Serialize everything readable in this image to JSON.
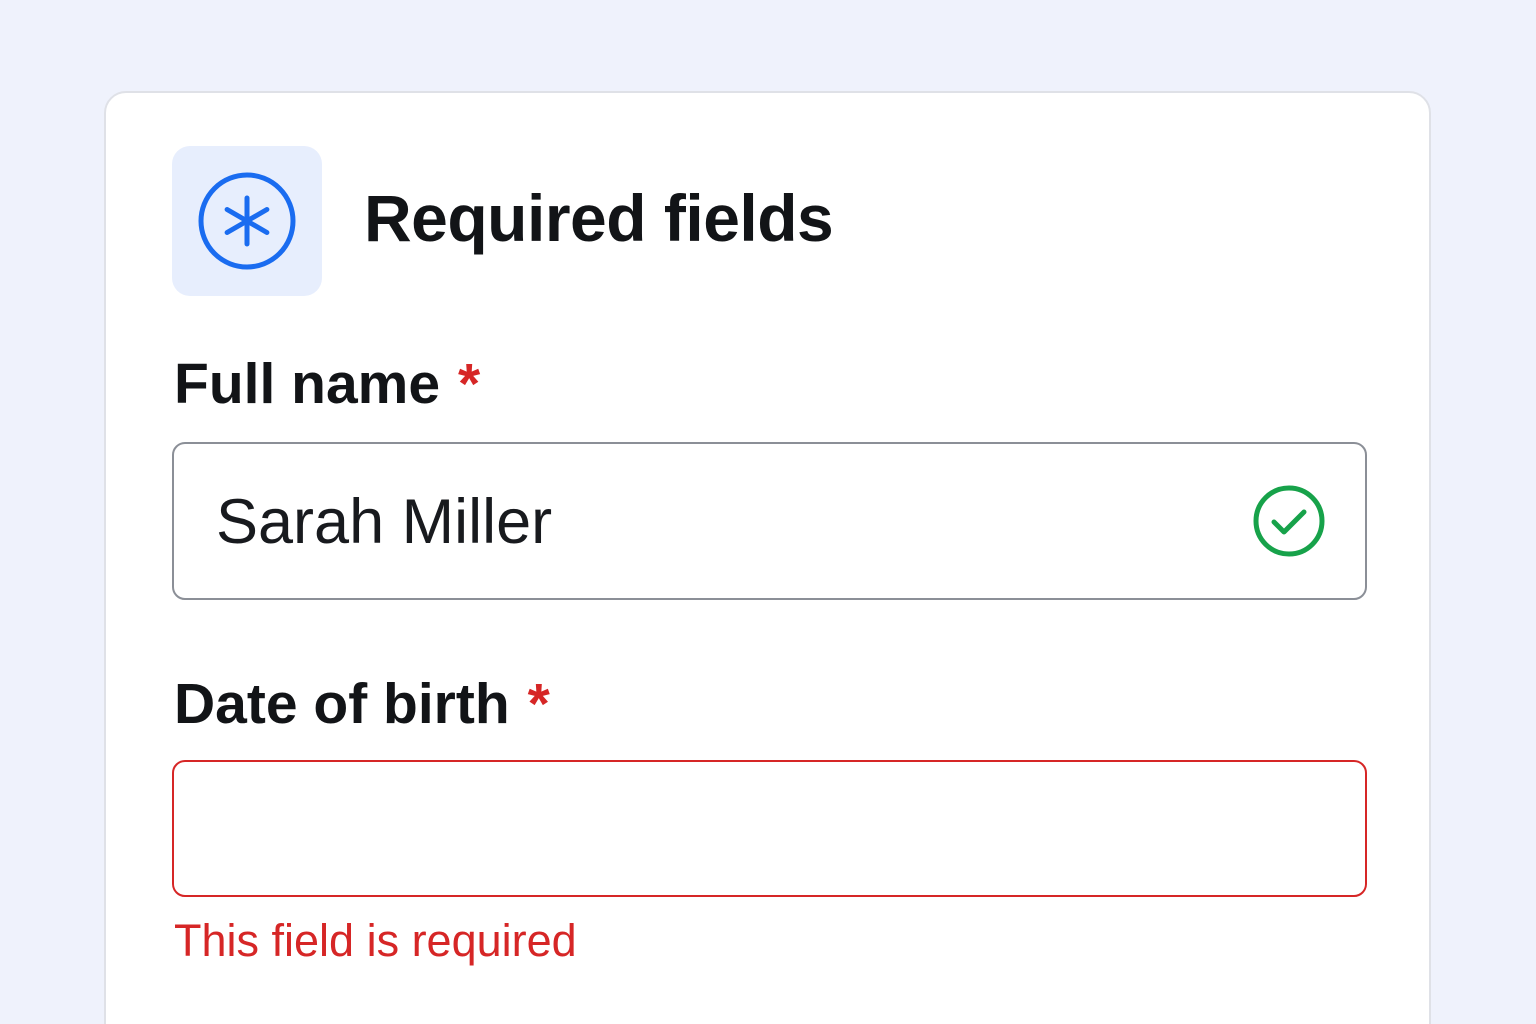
{
  "header": {
    "icon": "asterisk-circle-icon",
    "title": "Required fields"
  },
  "fields": [
    {
      "label": "Full name",
      "required_mark": "*",
      "value": "Sarah Miller",
      "status_icon": "check-circle-icon",
      "state": "valid"
    },
    {
      "label": "Date of birth",
      "required_mark": "*",
      "value": "",
      "state": "error",
      "error_message": "This field is required"
    }
  ],
  "colors": {
    "background": "#eff2fc",
    "accent_blue": "#1a6cf0",
    "error_red": "#d62626",
    "success_green": "#17a24a"
  }
}
